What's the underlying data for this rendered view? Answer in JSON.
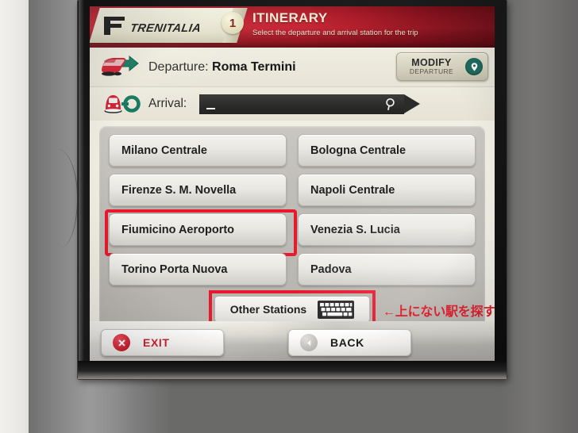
{
  "header": {
    "logo_text": "TRENITALIA",
    "logo_icon": "fs-logo-icon",
    "step_number": "1",
    "title": "ITINERARY",
    "subtitle": "Select the departure and arrival station for the trip",
    "accent_color": "#c42231",
    "title_color": "#f2ead2"
  },
  "departure": {
    "icon": "train-departure-icon",
    "label": "Departure:",
    "station": "Roma Termini",
    "modify_button": {
      "main": "MODIFY",
      "sub": "DEPARTURE",
      "icon": "location-pin-icon",
      "icon_color": "#1f6b5e"
    }
  },
  "arrival": {
    "icon": "train-arrival-icon",
    "label": "Arrival:",
    "value": "",
    "placeholder": "",
    "search_icon": "magnifier-icon"
  },
  "stations": {
    "left_column": [
      "Milano Centrale",
      "Firenze S. M. Novella",
      "Fiumicino Aeroporto",
      "Torino Porta Nuova"
    ],
    "right_column": [
      "Bologna Centrale",
      "Napoli Centrale",
      "Venezia S. Lucia",
      "Padova"
    ],
    "highlighted": "Fiumicino Aeroporto",
    "highlight_color": "#e8192c"
  },
  "other_stations": {
    "label": "Other Stations",
    "icon": "keyboard-icon",
    "highlighted": true
  },
  "annotation": {
    "text": "←上にない駅を探す",
    "color": "#e01020"
  },
  "footer": {
    "exit": {
      "label": "EXIT",
      "icon": "close-circle-icon",
      "color": "#cf2030"
    },
    "back": {
      "label": "BACK",
      "icon": "arrow-left-circle-icon",
      "color": "#1b1b1b"
    }
  }
}
